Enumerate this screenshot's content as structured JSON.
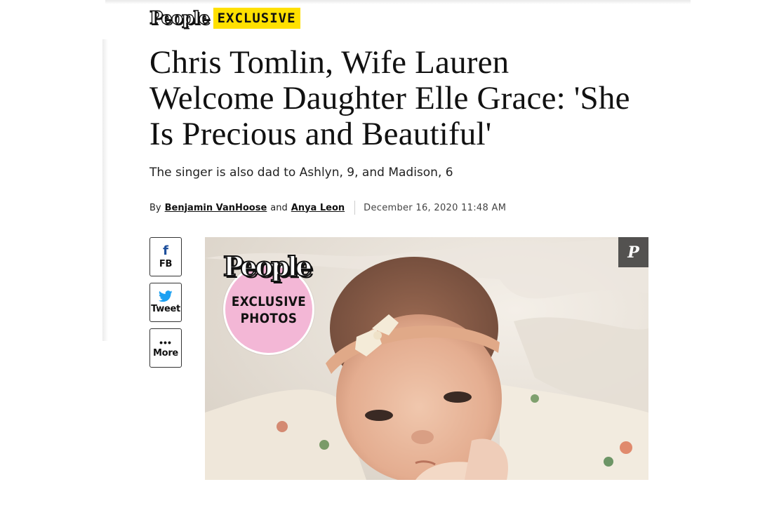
{
  "brand": {
    "logo_text": "People",
    "tag": "EXCLUSIVE"
  },
  "article": {
    "headline": "Chris Tomlin, Wife Lauren Welcome Daughter Elle Grace: 'She Is Precious and Beautiful'",
    "dek": "The singer is also dad to Ashlyn, 9, and Madison, 6",
    "byline": {
      "by": "By",
      "author1": "Benjamin VanHoose",
      "and": "and",
      "author2": "Anya Leon",
      "date": "December 16, 2020 11:48 AM"
    }
  },
  "share": {
    "fb": {
      "icon": "facebook-icon",
      "label": "FB"
    },
    "tweet": {
      "icon": "twitter-icon",
      "label": "Tweet"
    },
    "more": {
      "icon": "more-dots-icon",
      "label": "More"
    }
  },
  "photo": {
    "pin_icon": "pinterest-icon",
    "badge_logo": "People",
    "badge_line1": "EXCLUSIVE",
    "badge_line2": "PHOTOS"
  },
  "colors": {
    "exclusive_yellow": "#ffe000",
    "badge_pink": "#f3b7d6",
    "facebook_blue": "#1e4f9c",
    "twitter_blue": "#1da1f2"
  }
}
